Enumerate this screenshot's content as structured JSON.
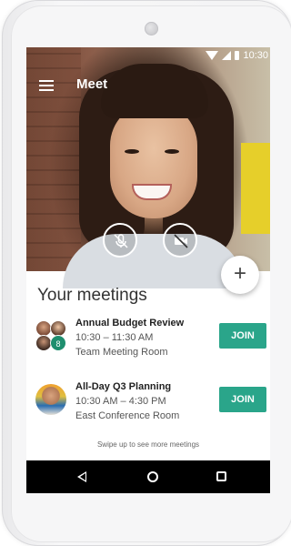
{
  "status": {
    "time": "10:30"
  },
  "appbar": {
    "title": "Meet"
  },
  "call_controls": {
    "mic_icon": "mic-off-icon",
    "camera_icon": "videocam-off-icon"
  },
  "fab": {
    "label": "+"
  },
  "meetings": {
    "section_title": "Your meetings",
    "items": [
      {
        "title": "Annual Budget Review",
        "time": "10:30 – 11:30 AM",
        "room": "Team Meeting Room",
        "participant_count": "8",
        "join_label": "JOIN"
      },
      {
        "title": "All-Day Q3 Planning",
        "time": "10:30 AM – 4:30 PM",
        "room": "East Conference Room",
        "join_label": "JOIN"
      }
    ],
    "swipe_hint": "Swipe up to see more meetings"
  },
  "colors": {
    "join": "#2aa58a",
    "participant_badge": "#1e8e6e"
  }
}
